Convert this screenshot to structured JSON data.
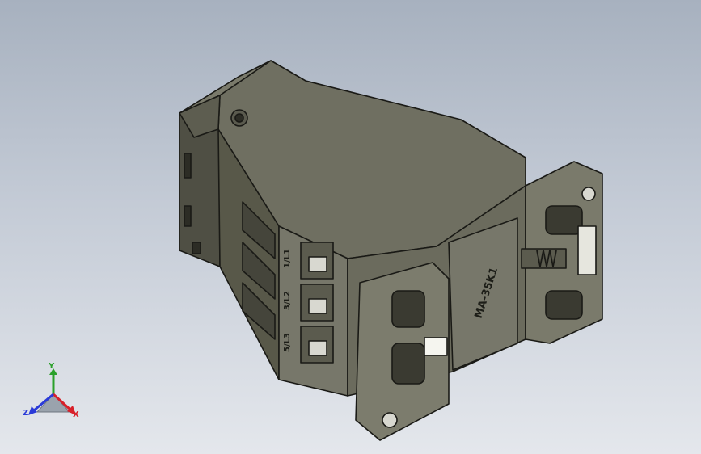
{
  "viewport": {
    "background_top": "#a7b1bf",
    "background_bottom": "#e4e7ec",
    "model_color": "#6b6b5d",
    "edge_color": "#1a1a16"
  },
  "part": {
    "label": "MA-35K1",
    "terminals": [
      "1/L1",
      "3/L2",
      "5/L3"
    ]
  },
  "triad": {
    "x_label": "X",
    "y_label": "Y",
    "z_label": "Z",
    "x_color": "#d8202a",
    "y_color": "#2aa02a",
    "z_color": "#2a3ad8"
  }
}
